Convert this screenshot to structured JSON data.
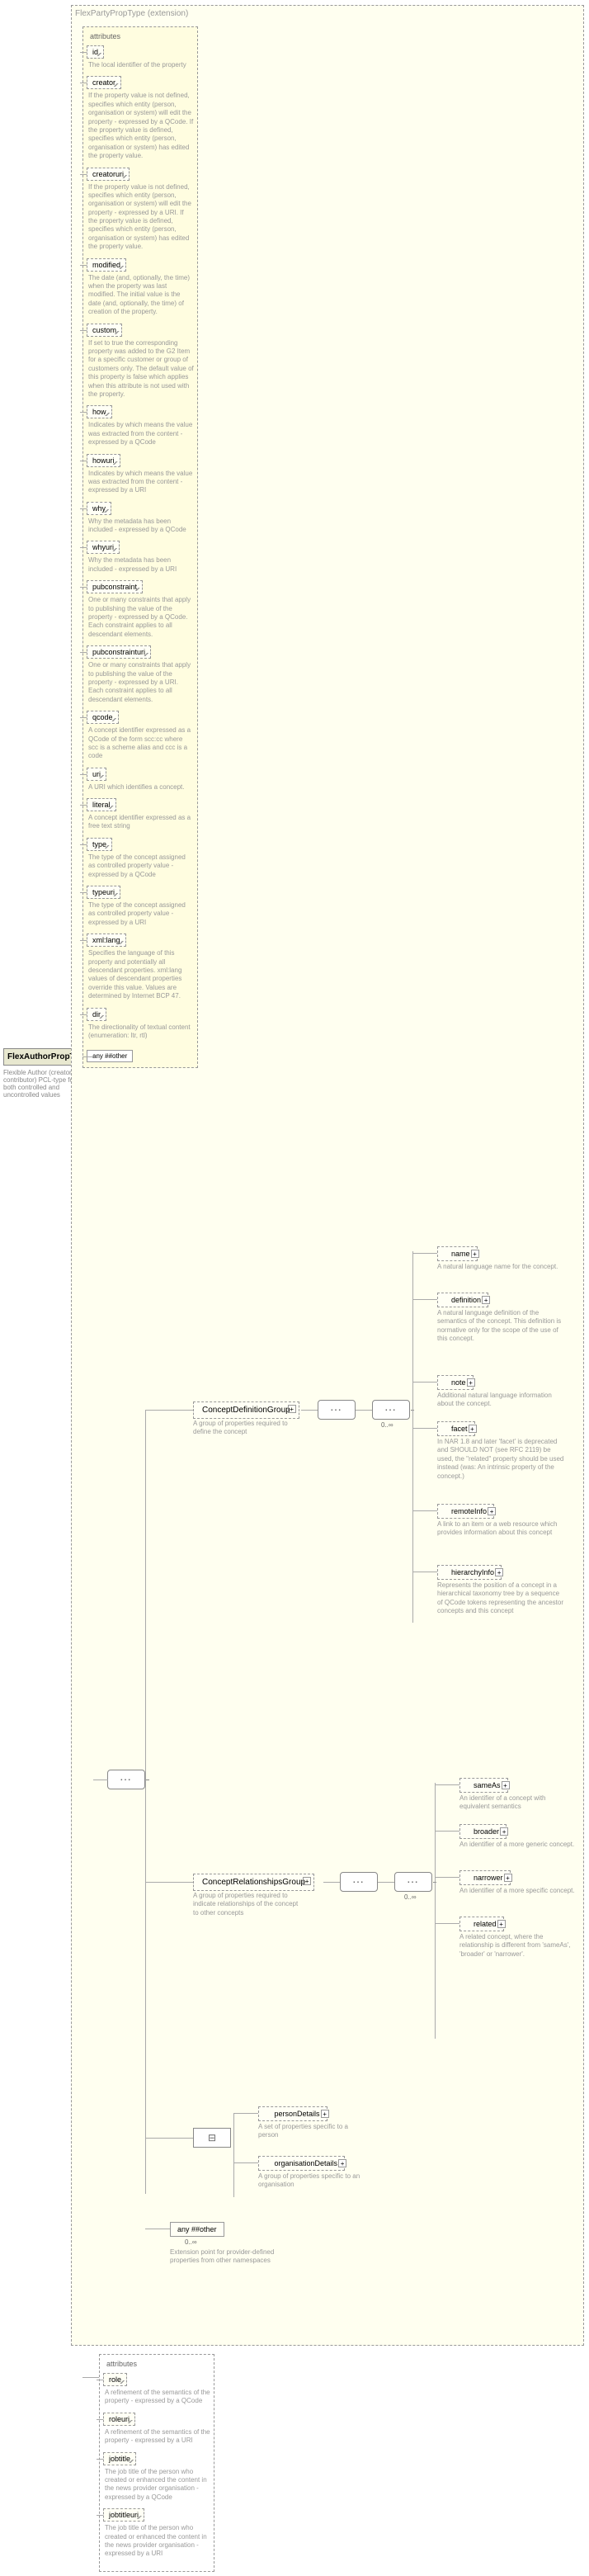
{
  "root": {
    "name": "FlexAuthorPropType",
    "desc": "Flexible Author (creator or contributor) PCL-type for both controlled and uncontrolled values"
  },
  "extension": {
    "title": "FlexPartyPropType",
    "suffix": "(extension)"
  },
  "attrs_main_title": "attributes",
  "attrs_main": [
    {
      "name": "id",
      "desc": "The local identifier of the property"
    },
    {
      "name": "creator",
      "desc": "If the property value is not defined, specifies which entity (person, organisation or system) will edit the property - expressed by a QCode. If the property value is defined, specifies which entity (person, organisation or system) has edited the property value."
    },
    {
      "name": "creatoruri",
      "desc": "If the property value is not defined, specifies which entity (person, organisation or system) will edit the property - expressed by a URI. If the property value is defined, specifies which entity (person, organisation or system) has edited the property value."
    },
    {
      "name": "modified",
      "desc": "The date (and, optionally, the time) when the property was last modified. The initial value is the date (and, optionally, the time) of creation of the property."
    },
    {
      "name": "custom",
      "desc": "If set to true the corresponding property was added to the G2 Item for a specific customer or group of customers only. The default value of this property is false which applies when this attribute is not used with the property."
    },
    {
      "name": "how",
      "desc": "Indicates by which means the value was extracted from the content - expressed by a QCode"
    },
    {
      "name": "howuri",
      "desc": "Indicates by which means the value was extracted from the content - expressed by a URI"
    },
    {
      "name": "why",
      "desc": "Why the metadata has been included - expressed by a QCode"
    },
    {
      "name": "whyuri",
      "desc": "Why the metadata has been included - expressed by a URI"
    },
    {
      "name": "pubconstraint",
      "desc": "One or many constraints that apply to publishing the value of the property - expressed by a QCode. Each constraint applies to all descendant elements."
    },
    {
      "name": "pubconstrainturi",
      "desc": "One or many constraints that apply to publishing the value of the property - expressed by a URI. Each constraint applies to all descendant elements."
    },
    {
      "name": "qcode",
      "desc": "A concept identifier expressed as a QCode of the form scc:cc where scc is a scheme alias and ccc is a code"
    },
    {
      "name": "uri",
      "desc": "A URI which identifies a concept."
    },
    {
      "name": "literal",
      "desc": "A concept identifier expressed as a free text string"
    },
    {
      "name": "type",
      "desc": "The type of the concept assigned as controlled property value - expressed by a QCode"
    },
    {
      "name": "typeuri",
      "desc": "The type of the concept assigned as controlled property value - expressed by a URI"
    },
    {
      "name": "xml:lang",
      "desc": "Specifies the language of this property and potentially all descendant properties. xml:lang values of descendant properties override this value. Values are determined by Internet BCP 47."
    },
    {
      "name": "dir",
      "desc": "The directionality of textual content (enumeration: ltr, rtl)"
    }
  ],
  "other_label": "any ##other",
  "groups": {
    "cdg": {
      "name": "ConceptDefinitionGroup",
      "desc": "A group of properties required to define the concept"
    },
    "crg": {
      "name": "ConceptRelationshipsGroup",
      "desc": "A group of properties required to indicate relationships of the concept to other concepts"
    }
  },
  "cdg_elems": [
    {
      "name": "name",
      "desc": "A natural language name for the concept."
    },
    {
      "name": "definition",
      "desc": "A natural language definition of the semantics of the concept. This definition is normative only for the scope of the use of this concept."
    },
    {
      "name": "note",
      "desc": "Additional natural language information about the concept."
    },
    {
      "name": "facet",
      "desc": "In NAR 1.8 and later 'facet' is deprecated and SHOULD NOT (see RFC 2119) be used, the \"related\" property should be used instead (was: An intrinsic property of the concept.)"
    },
    {
      "name": "remoteInfo",
      "desc": "A link to an item or a web resource which provides information about this concept"
    },
    {
      "name": "hierarchyInfo",
      "desc": "Represents the position of a concept in a hierarchical taxonomy tree by a sequence of QCode tokens representing the ancestor concepts and this concept"
    }
  ],
  "crg_elems": [
    {
      "name": "sameAs",
      "desc": "An identifier of a concept with equivalent semantics"
    },
    {
      "name": "broader",
      "desc": "An identifier of a more generic concept."
    },
    {
      "name": "narrower",
      "desc": "An identifier of a more specific concept."
    },
    {
      "name": "related",
      "desc": "A related concept, where the relationship is different from 'sameAs', 'broader' or 'narrower'."
    }
  ],
  "details": {
    "person": {
      "name": "personDetails",
      "desc": "A set of properties specific to a person"
    },
    "org": {
      "name": "organisationDetails",
      "desc": "A group of properties specific to an organisation"
    }
  },
  "ext_point": {
    "label": "any ##other",
    "card": "0..∞",
    "desc": "Extension point for provider-defined properties from other namespaces"
  },
  "attrs_bottom_title": "attributes",
  "attrs_bottom": [
    {
      "name": "role",
      "desc": "A refinement of the semantics of the property - expressed by a QCode"
    },
    {
      "name": "roleuri",
      "desc": "A refinement of the semantics of the property - expressed by a URI"
    },
    {
      "name": "jobtitle",
      "desc": "The job title of the person who created or enhanced the content in the news provider organisation - expressed by a QCode"
    },
    {
      "name": "jobtitleuri",
      "desc": "The job title of the person who created or enhanced the content in the news provider organisation - expressed by a URI"
    }
  ],
  "card": "0..∞"
}
